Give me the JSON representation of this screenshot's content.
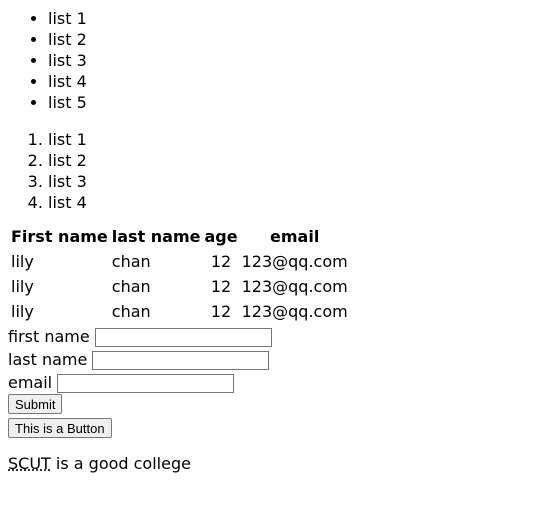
{
  "unordered_list": [
    "list 1",
    "list 2",
    "list 3",
    "list 4",
    "list 5"
  ],
  "ordered_list": [
    "list 1",
    "list 2",
    "list 3",
    "list 4"
  ],
  "table": {
    "headers": [
      "First name",
      "last name",
      "age",
      "email"
    ],
    "rows": [
      [
        "lily",
        "chan",
        "12",
        "123@qq.com"
      ],
      [
        "lily",
        "chan",
        "12",
        "123@qq.com"
      ],
      [
        "lily",
        "chan",
        "12",
        "123@qq.com"
      ]
    ]
  },
  "form": {
    "first_name_label": "first name",
    "first_name_value": "",
    "last_name_label": "last name",
    "last_name_value": "",
    "email_label": "email",
    "email_value": "",
    "submit_label": "Submit"
  },
  "button_label": "This is a Button",
  "paragraph": {
    "abbr": "SCUT",
    "text": " is a good college"
  }
}
